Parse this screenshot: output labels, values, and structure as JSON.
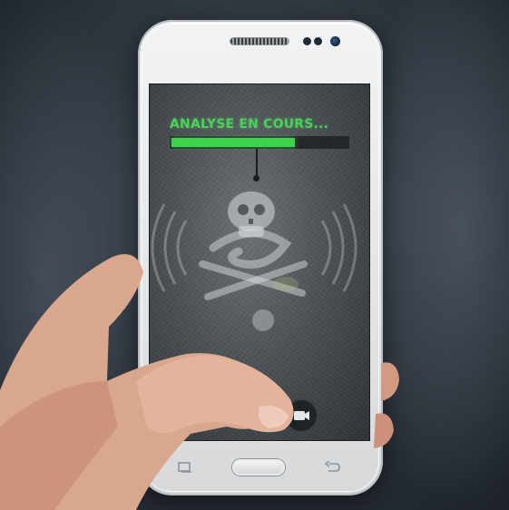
{
  "screen": {
    "status_label": "ANALYSE EN COURS...",
    "progress_fraction": 0.7
  },
  "colors": {
    "accent_green": "#3fd24c",
    "phone_body": "#e8eaec",
    "screen_bg": "#4d5256"
  },
  "icons": {
    "record": "video-camera-icon",
    "recent": "recent-apps-icon",
    "back": "back-arrow-icon",
    "home": "home-button"
  }
}
